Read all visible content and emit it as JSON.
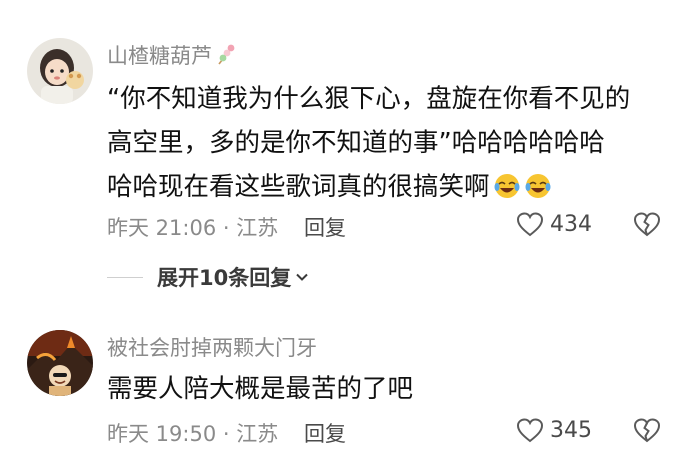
{
  "comments": [
    {
      "username": "山楂糖葫芦",
      "username_decoration": "tanghulu-icon",
      "lines": [
        "“你不知道我为什么狠下心，盘旋在你看不见的",
        "高空里，多的是你不知道的事”哈哈哈哈哈哈",
        "哈哈现在看这些歌词真的很搞笑啊"
      ],
      "emojis": [
        "tears-of-joy-emoji",
        "tears-of-joy-emoji"
      ],
      "meta": "昨天 21:06 · 江苏",
      "reply_label": "回复",
      "like_count": "434"
    },
    {
      "username": "被社会肘掉两颗大门牙",
      "lines": [
        "需要人陪大概是最苦的了吧"
      ],
      "meta": "昨天 19:50 · 江苏",
      "reply_label": "回复",
      "like_count": "345"
    }
  ],
  "expand": {
    "label": "展开10条回复"
  },
  "colors": {
    "secondary_text": "#8a8a8a",
    "primary_text": "#111111",
    "emoji_yellow": "#f7c531",
    "emoji_tear": "#5aa9e6"
  }
}
